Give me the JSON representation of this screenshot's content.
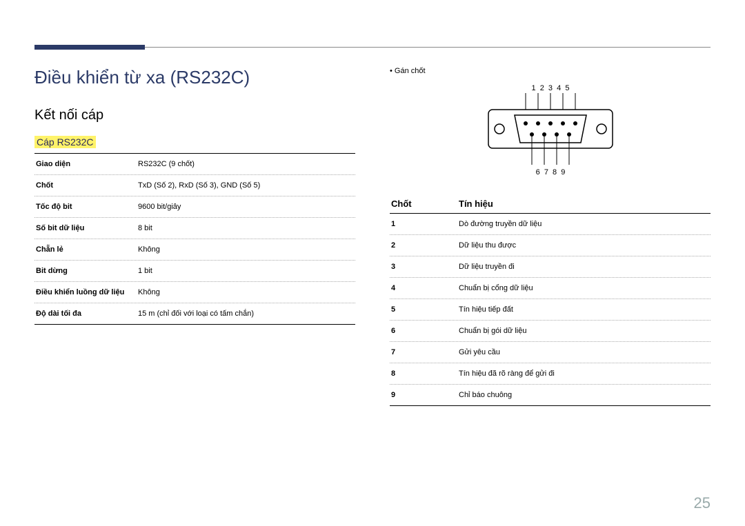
{
  "title": "Điều khiển từ xa (RS232C)",
  "section": "Kết nối cáp",
  "cable_label": "Cáp RS232C",
  "spec_rows": [
    {
      "k": "Giao diện",
      "v": "RS232C (9 chốt)"
    },
    {
      "k": "Chốt",
      "v": "TxD (Số 2), RxD (Số 3), GND (Số 5)"
    },
    {
      "k": "Tốc độ bit",
      "v": "9600 bit/giây"
    },
    {
      "k": "Số bit dữ liệu",
      "v": "8 bit"
    },
    {
      "k": "Chẵn lẻ",
      "v": "Không"
    },
    {
      "k": "Bit dừng",
      "v": "1 bit"
    },
    {
      "k": "Điều khiển luồng dữ liệu",
      "v": "Không"
    },
    {
      "k": "Độ dài tối đa",
      "v": "15 m (chỉ đối với loại có tấm chắn)"
    }
  ],
  "pin_assign_label": "Gán chốt",
  "top_nums": "1  2  3  4  5",
  "bottom_nums": "6  7  8  9",
  "pin_header": {
    "c1": "Chốt",
    "c2": "Tín hiệu"
  },
  "pin_rows": [
    {
      "n": "1",
      "s": "Dò đường truyền dữ liệu"
    },
    {
      "n": "2",
      "s": "Dữ liệu thu được"
    },
    {
      "n": "3",
      "s": "Dữ liệu truyền đi"
    },
    {
      "n": "4",
      "s": "Chuẩn bị cổng dữ liệu"
    },
    {
      "n": "5",
      "s": "Tín hiệu tiếp đất"
    },
    {
      "n": "6",
      "s": "Chuẩn bị gói dữ liệu"
    },
    {
      "n": "7",
      "s": "Gửi yêu cầu"
    },
    {
      "n": "8",
      "s": "Tín hiệu đã rõ ràng để gửi đi"
    },
    {
      "n": "9",
      "s": "Chỉ báo chuông"
    }
  ],
  "page_number": "25"
}
